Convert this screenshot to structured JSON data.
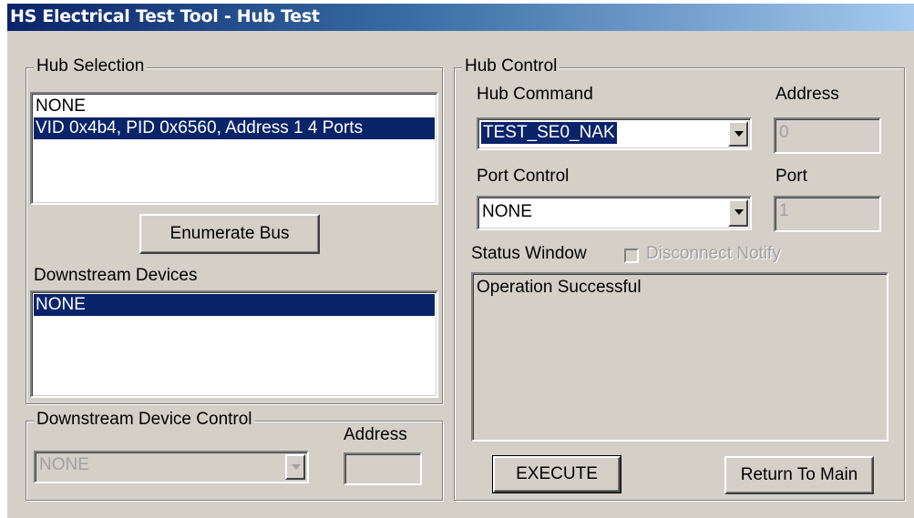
{
  "window": {
    "title": "HS Electrical Test Tool - Hub Test"
  },
  "hub_selection": {
    "legend": "Hub Selection",
    "items": [
      "NONE",
      "VID 0x4b4, PID 0x6560, Address 1  4 Ports"
    ],
    "selected_index": 1,
    "enumerate_label": "Enumerate Bus",
    "downstream_label": "Downstream Devices",
    "downstream_items": [
      "NONE"
    ]
  },
  "downstream_control": {
    "legend": "Downstream Device Control",
    "address_label": "Address",
    "device_value": "NONE",
    "address_value": ""
  },
  "hub_control": {
    "legend": "Hub Control",
    "command_label": "Hub Command",
    "command_value": "TEST_SE0_NAK",
    "address_label": "Address",
    "address_value": "0",
    "port_control_label": "Port Control",
    "port_control_value": "NONE",
    "port_label": "Port",
    "port_value": "1",
    "status_label": "Status Window",
    "disconnect_label": "Disconnect Notify",
    "disconnect_checked": false,
    "status_text": "Operation Successful",
    "execute_label": "EXECUTE",
    "return_label": "Return To Main"
  },
  "colors": {
    "selection": "#0a246a",
    "face": "#d4d0c8"
  }
}
